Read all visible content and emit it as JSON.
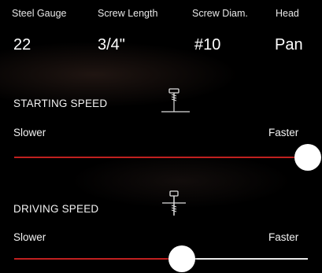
{
  "specs": {
    "columns": [
      {
        "header": "Steel Gauge",
        "value": "22"
      },
      {
        "header": "Screw Length",
        "value": "3/4\""
      },
      {
        "header": "Screw Diam.",
        "value": "#10"
      },
      {
        "header": "Head",
        "value": "Pan"
      }
    ]
  },
  "starting_speed": {
    "title": "STARTING SPEED",
    "min_label": "Slower",
    "max_label": "Faster",
    "value": 1.0,
    "icon": "screw-start-icon"
  },
  "driving_speed": {
    "title": "DRIVING SPEED",
    "min_label": "Slower",
    "max_label": "Faster",
    "value": 0.57,
    "icon": "screw-drive-icon"
  },
  "colors": {
    "accent": "#c0201f",
    "track": "#e9e9e9",
    "background": "#000000"
  }
}
